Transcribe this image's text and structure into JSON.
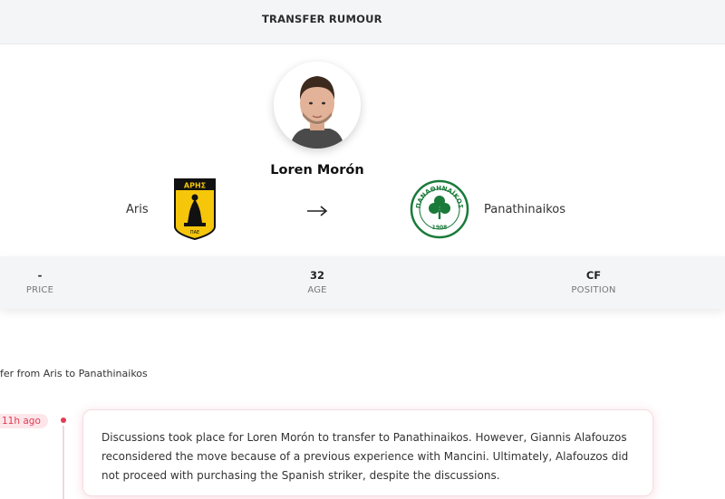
{
  "header": {
    "title": "TRANSFER RUMOUR"
  },
  "player": {
    "name": "Loren Morón"
  },
  "transfer": {
    "from_club": "Aris",
    "to_club": "Panathinaikos",
    "arrow": "→"
  },
  "crests": {
    "from_text_top": "ΑΡΗΣ",
    "from_text_bottom": "ΠΑΕ",
    "to_text_ring": "ΠΑΝΑΘΗΝΑΪΚΟΣ",
    "to_text_year": "1908"
  },
  "stats": {
    "price": {
      "value": "-",
      "label": "PRICE"
    },
    "age": {
      "value": "32",
      "label": "AGE"
    },
    "position": {
      "value": "CF",
      "label": "POSITION"
    }
  },
  "subtitle": "fer from Aris to Panathinaikos",
  "timeline": {
    "time": "11h ago",
    "text": "Discussions took place for Loren Morón to transfer to Panathinaikos. However, Giannis Alafouzos reconsidered the move because of a previous experience with Mancini. Ultimately, Alafouzos did not proceed with purchasing the Spanish striker, despite the discussions."
  },
  "colors": {
    "accent": "#e23b54",
    "aris_yellow": "#f6c60a",
    "panathinaikos_green": "#1a7a3a"
  }
}
